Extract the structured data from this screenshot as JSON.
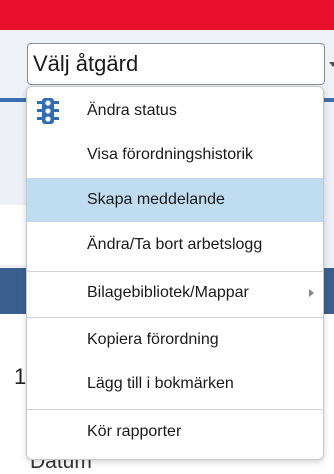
{
  "action_select": {
    "value": "Välj åtgärd"
  },
  "menu": {
    "items": [
      {
        "label": "Ändra status",
        "icon": "traffic-light-icon"
      },
      {
        "label": "Visa förordningshistorik"
      },
      {
        "label": "Skapa meddelande",
        "highlighted": true
      },
      {
        "label": "Ändra/Ta bort arbetslogg"
      },
      {
        "label": "Bilagebibliotek/Mappar",
        "has_submenu": true
      },
      {
        "label": "Kopiera förordning"
      },
      {
        "label": "Lägg till i bokmärken"
      },
      {
        "label": "Kör rapporter"
      }
    ]
  },
  "background": {
    "digit": "1",
    "datum_label": "Datum"
  },
  "colors": {
    "top_bar": "#e8102a",
    "highlight": "#bfdcf1",
    "icon_blue": "#2f6db5"
  }
}
